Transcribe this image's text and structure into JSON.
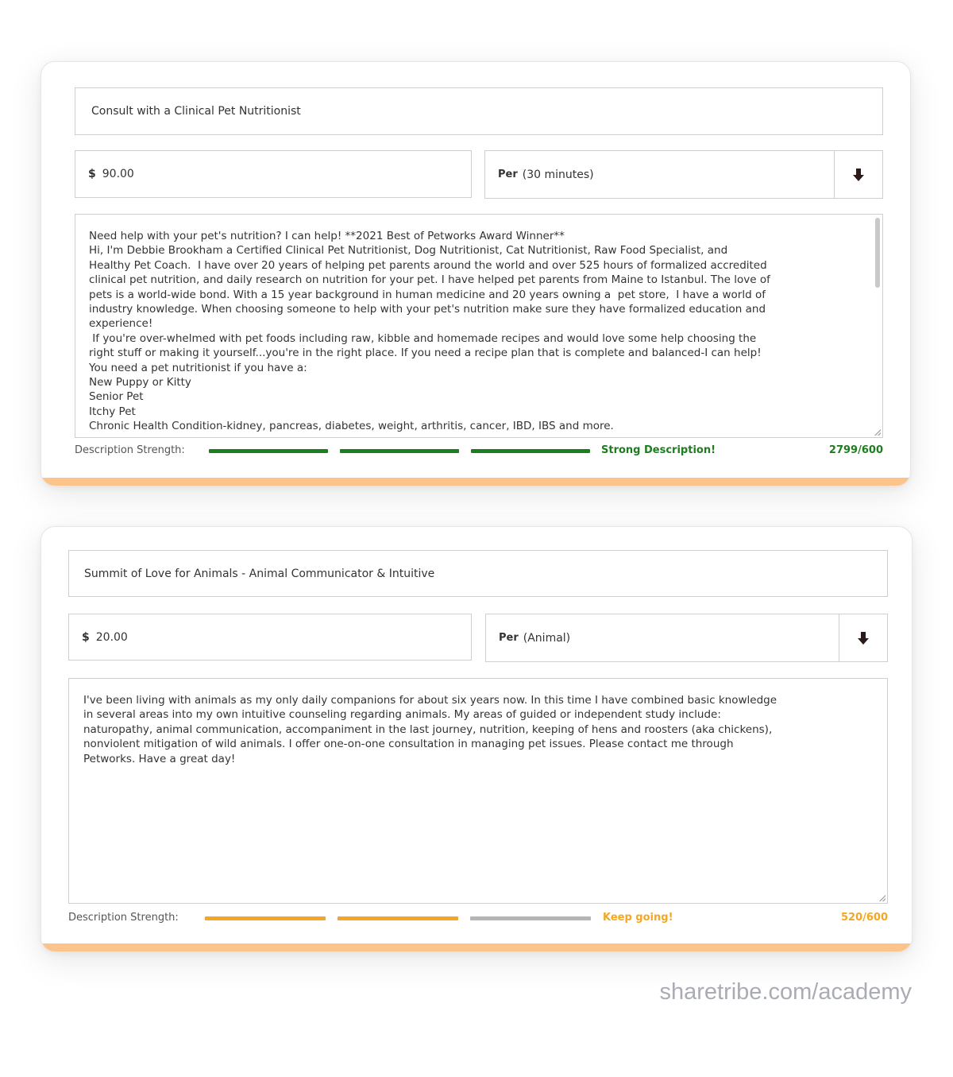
{
  "listings": [
    {
      "title": "Consult with a Clinical Pet Nutritionist",
      "currency_symbol": "$",
      "price": "90.00",
      "per_label": "Per",
      "per_value": "(30 minutes)",
      "description": "Need help with your pet's nutrition? I can help! **2021 Best of Petworks Award Winner**\nHi, I'm Debbie Brookham a Certified Clinical Pet Nutritionist, Dog Nutritionist, Cat Nutritionist, Raw Food Specialist, and\nHealthy Pet Coach.  I have over 20 years of helping pet parents around the world and over 525 hours of formalized accredited\nclinical pet nutrition, and daily research on nutrition for your pet. I have helped pet parents from Maine to Istanbul. The love of\npets is a world-wide bond. With a 15 year background in human medicine and 20 years owning a  pet store,  I have a world of\nindustry knowledge. When choosing someone to help with your pet's nutrition make sure they have formalized education and\nexperience!\n If you're over-whelmed with pet foods including raw, kibble and homemade recipes and would love some help choosing the\nright stuff or making it yourself...you're in the right place. If you need a recipe plan that is complete and balanced-I can help!\nYou need a pet nutritionist if you have a:\nNew Puppy or Kitty\nSenior Pet\nItchy Pet\nChronic Health Condition-kidney, pancreas, diabetes, weight, arthritis, cancer, IBD, IBS and more.",
      "strength_label": "Description Strength:",
      "strength_status": "Strong Description!",
      "char_count": "2799/600",
      "strength_level": 3,
      "strength_max": 3,
      "colors": {
        "active": "#1e7d1e",
        "inactive": "#b5b5b5",
        "text": "#1e7d1e"
      }
    },
    {
      "title": "Summit of Love for Animals - Animal Communicator & Intuitive",
      "currency_symbol": "$",
      "price": "20.00",
      "per_label": "Per",
      "per_value": "(Animal)",
      "description": "I've been living with animals as my only daily companions for about six years now. In this time I have combined basic knowledge\nin several areas into my own intuitive counseling regarding animals. My areas of guided or independent study include:\nnaturopathy, animal communication, accompaniment in the last journey, nutrition, keeping of hens and roosters (aka chickens),\nnonviolent mitigation of wild animals. I offer one-on-one consultation in managing pet issues. Please contact me through\nPetworks. Have a great day!",
      "strength_label": "Description Strength:",
      "strength_status": "Keep going!",
      "char_count": "520/600",
      "strength_level": 2,
      "strength_max": 3,
      "colors": {
        "active": "#f5a623",
        "inactive": "#b5b5b5",
        "text": "#f5a623"
      }
    }
  ],
  "watermark": "sharetribe.com/academy",
  "accent_bottom": "#fcc48a"
}
